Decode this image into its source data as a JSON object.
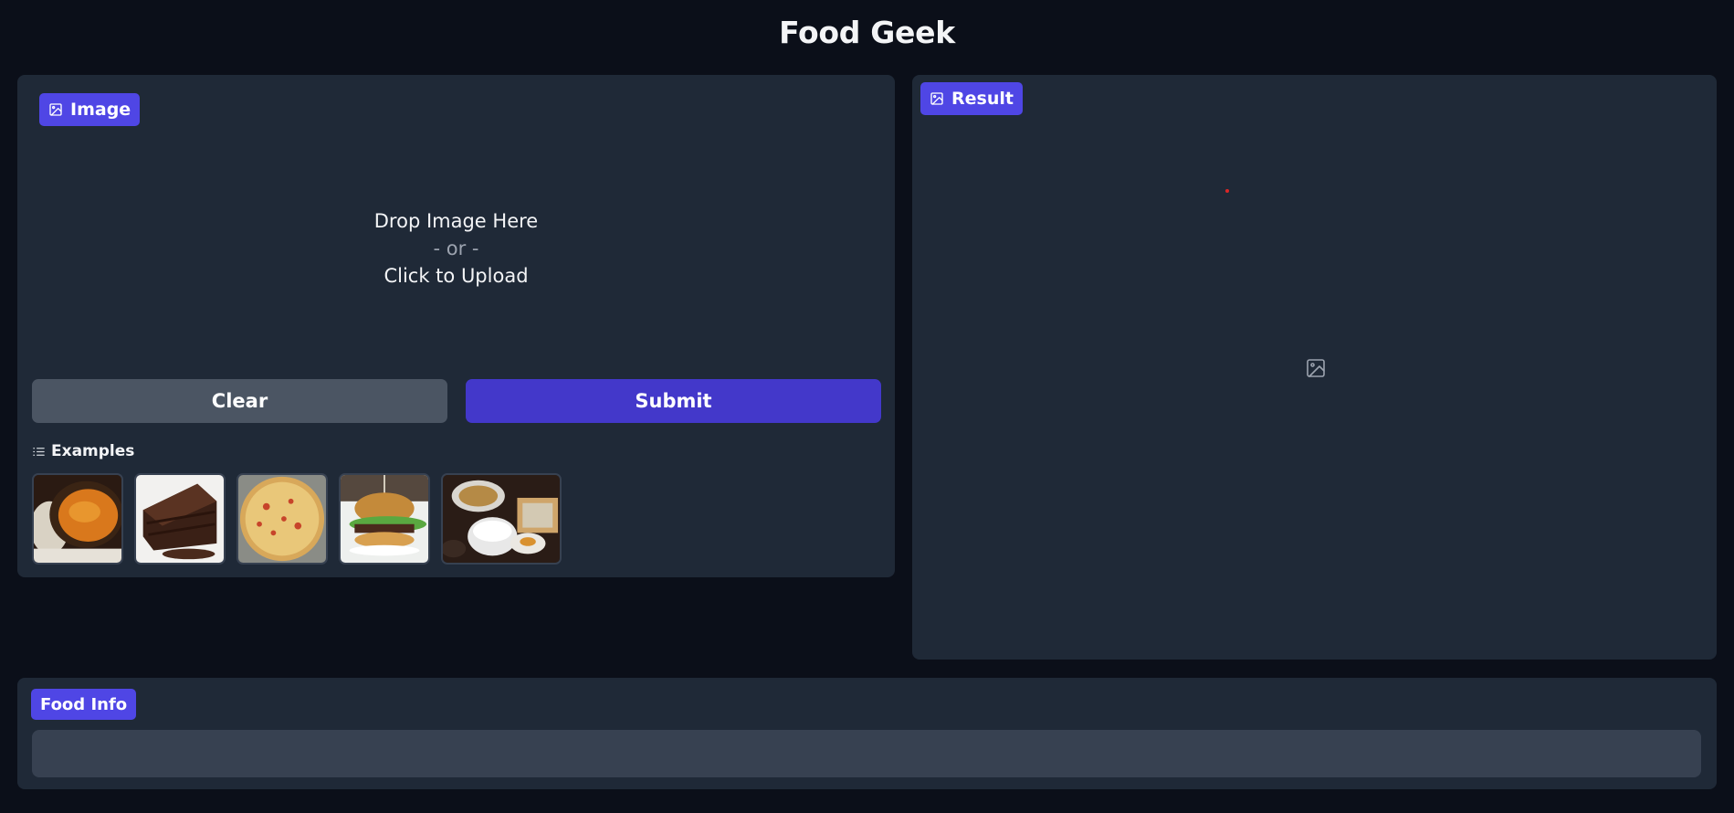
{
  "app": {
    "title": "Food Geek"
  },
  "input_panel": {
    "label": "Image",
    "drop_text": "Drop Image Here",
    "or_text": "- or -",
    "upload_text": "Click to Upload",
    "clear_label": "Clear",
    "submit_label": "Submit",
    "examples_label": "Examples",
    "examples": [
      {
        "name": "curry-dish"
      },
      {
        "name": "chocolate-cake"
      },
      {
        "name": "pizza"
      },
      {
        "name": "hamburger"
      },
      {
        "name": "japanese-meal"
      }
    ]
  },
  "result_panel": {
    "label": "Result",
    "icon": "image-icon"
  },
  "info_panel": {
    "label": "Food Info",
    "value": ""
  },
  "colors": {
    "background": "#0b0f19",
    "panel": "#1f2937",
    "accent": "#4f46e5",
    "submit": "#4338ca",
    "clear": "#4b5563",
    "textbox": "#374151"
  }
}
